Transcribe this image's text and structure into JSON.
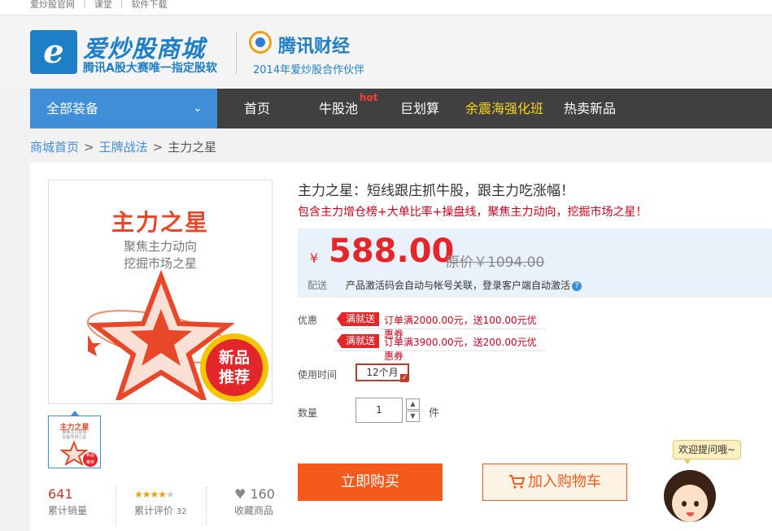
{
  "topbar": {
    "links": [
      "爱炒股官网",
      "课堂",
      "软件下载"
    ]
  },
  "header": {
    "logo_letter": "e",
    "brand_name": "爱炒股商城",
    "brand_sub": "腾讯A股大赛唯一指定股软",
    "partner_name": "腾讯财经",
    "partner_sub": "2014年爱炒股合作伙伴"
  },
  "nav": {
    "all_label": "全部装备",
    "items": [
      "首页",
      "牛股池",
      "巨划算",
      "余震海强化班",
      "热卖新品"
    ],
    "hot_badge": "hot",
    "highlight_color": "#f6d31c"
  },
  "breadcrumb": {
    "home": "商城首页",
    "category": "王牌战法",
    "current": "主力之星",
    "sep": ">"
  },
  "product_image": {
    "title": "主力之星",
    "sub1": "聚焦主力动向",
    "sub2": "挖掘市场之星",
    "badge1": "新品",
    "badge2": "推荐"
  },
  "stats": {
    "sales": "641",
    "sales_label": "累计销量",
    "rating_label": "累计评价",
    "rating_count": "32",
    "rating_stars": 4,
    "fav": "160",
    "fav_label": "收藏商品"
  },
  "product": {
    "title": "主力之星：短线跟庄抓牛股，跟主力吃涨幅！",
    "slogan": "包含主力增仓榜+大单比率+操盘线，聚焦主力动向，挖掘市场之星！",
    "currency": "¥",
    "price": "588.00",
    "original_price": "原价￥1094.00",
    "delivery_label": "配送",
    "delivery_text": "产品激活码会自动与帐号关联，登录客户端自动激活",
    "promo_label": "优惠",
    "promos": [
      {
        "tag": "满就送",
        "text": "订单满2000.00元，送100.00元优惠券"
      },
      {
        "tag": "满就送",
        "text": "订单满3900.00元，送200.00元优惠券"
      }
    ],
    "duration_label": "使用时间",
    "duration_value": "12个月",
    "qty_label": "数量",
    "qty_value": "1",
    "qty_unit": "件",
    "buy_label": "立即购买",
    "cart_label": "加入购物车"
  },
  "chat": {
    "bubble": "欢迎提问哦~"
  }
}
